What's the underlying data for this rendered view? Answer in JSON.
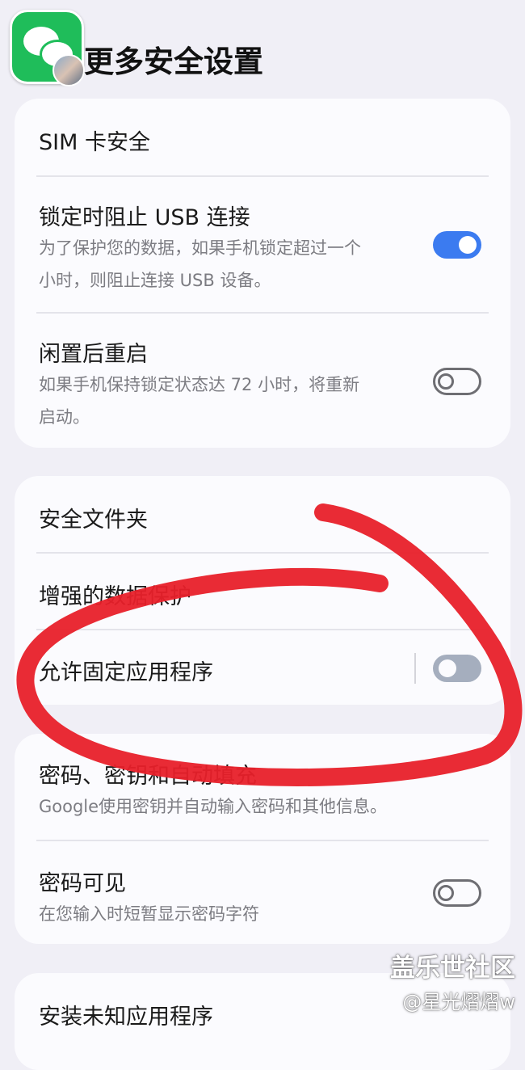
{
  "header": {
    "title": "更多安全设置",
    "app_icon": "wechat-icon"
  },
  "card1": {
    "sim": {
      "title": "SIM 卡安全"
    },
    "usb": {
      "title": "锁定时阻止 USB 连接",
      "sub1": "为了保护您的数据，如果手机锁定超过一个",
      "sub2": "小时，则阻止连接 USB 设备。",
      "enabled": true
    },
    "restart": {
      "title": "闲置后重启",
      "sub1": "如果手机保持锁定状态达 72 小时，将重新",
      "sub2": "启动。",
      "enabled": false
    }
  },
  "card2": {
    "folder": {
      "title": "安全文件夹"
    },
    "enhanced": {
      "title": "增强的数据保护"
    },
    "pin_apps": {
      "title": "允许固定应用程序",
      "enabled": false
    }
  },
  "card3": {
    "passkeys": {
      "title": "密码、密钥和自动填充",
      "sub": "Google使用密钥并自动输入密码和其他信息。"
    },
    "visible": {
      "title": "密码可见",
      "sub": "在您输入时短暂显示密码字符",
      "enabled": false
    }
  },
  "card4": {
    "unknown": {
      "title": "安装未知应用程序"
    }
  },
  "watermark": {
    "line1": "盖乐世社区",
    "line2": "@星光熠熠w"
  },
  "colors": {
    "accent": "#3b7bf0",
    "annotation": "#e8202a"
  }
}
